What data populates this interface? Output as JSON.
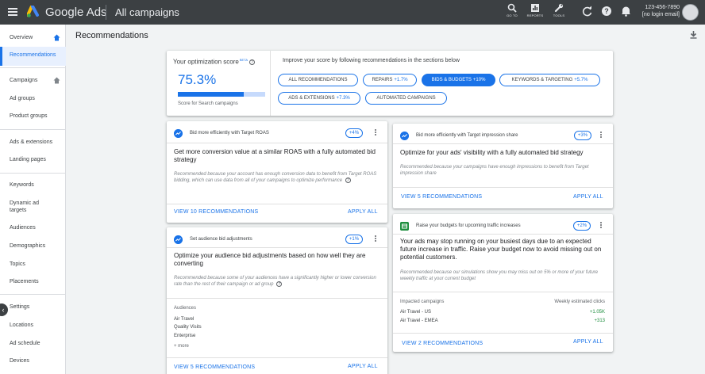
{
  "topbar": {
    "brand": "Google Ads",
    "page_name": "All campaigns",
    "tools": [
      {
        "label": "GO TO",
        "icon": "search-icon"
      },
      {
        "label": "REPORTS",
        "icon": "reports-icon"
      },
      {
        "label": "TOOLS",
        "icon": "wrench-icon"
      }
    ],
    "account_id": "123-456-7890",
    "account_email": "[no login email]"
  },
  "sidebar": {
    "items": [
      {
        "label": "Overview"
      },
      {
        "label": "Recommendations",
        "active": true
      },
      {
        "label": "Campaigns"
      },
      {
        "label": "Ad groups"
      },
      {
        "label": "Product groups"
      },
      {
        "label": "Ads & extensions"
      },
      {
        "label": "Landing pages"
      },
      {
        "label": "Keywords"
      },
      {
        "label": "Dynamic ad targets"
      },
      {
        "label": "Audiences"
      },
      {
        "label": "Demographics"
      },
      {
        "label": "Topics"
      },
      {
        "label": "Placements"
      },
      {
        "label": "Settings"
      },
      {
        "label": "Locations"
      },
      {
        "label": "Ad schedule"
      },
      {
        "label": "Devices"
      }
    ]
  },
  "main": {
    "title": "Recommendations",
    "score": {
      "label": "Your optimization score",
      "beta": "BETA",
      "value": "75.3%",
      "fraction": 0.753,
      "sub": "Score for Search campaigns",
      "improve_text": "Improve your score by following recommendations in the sections below"
    },
    "chips": [
      {
        "label": "ALL RECOMMENDATIONS",
        "delta": ""
      },
      {
        "label": "REPAIRS",
        "delta": "+1.7%"
      },
      {
        "label": "BIDS & BUDGETS",
        "delta": "+10%",
        "active": true
      },
      {
        "label": "KEYWORDS & TARGETING",
        "delta": "+5.7%"
      },
      {
        "label": "ADS & EXTENSIONS",
        "delta": "+7.3%"
      },
      {
        "label": "AUTOMATED CAMPAIGNS",
        "delta": ""
      }
    ],
    "cards": {
      "target_roas": {
        "head": "Bid more efficiently with Target ROAS",
        "uplift": "+4%",
        "title": "Get more conversion value at a similar ROAS with a fully automated bid strategy",
        "reason": "Recommended because your account has enough conversion data to benefit from Target ROAS bidding, which can use data from all of your campaigns to optimize performance",
        "view": "VIEW 10 RECOMMENDATIONS",
        "apply": "APPLY ALL"
      },
      "audience": {
        "head": "Set audience bid adjustments",
        "uplift": "+1%",
        "title": "Optimize your audience bid adjustments based on how well they are converting",
        "reason": "Recommended because some of your audiences have a significantly higher or lower conversion rate than the rest of their campaign or ad group",
        "audiences_label": "Audiences",
        "audiences": [
          "Air Travel",
          "Quality Visits",
          "Enterprise"
        ],
        "more": "+ more",
        "view": "VIEW 5 RECOMMENDATIONS",
        "apply": "APPLY ALL"
      },
      "impression_share": {
        "head": "Bid more efficiently with Target impression share",
        "uplift": "+3%",
        "title": "Optimize for your ads' visibility with a fully automated bid strategy",
        "reason": "Recommended because your campaigns have enough impressions to benefit from Target impression share",
        "view": "VIEW 5 RECOMMENDATIONS",
        "apply": "APPLY ALL"
      },
      "budgets": {
        "head": "Raise your budgets for upcoming traffic increases",
        "uplift": "+2%",
        "title": "Your ads may stop running on your busiest days due to an expected future increase in traffic. Raise your budget now to avoid missing out on potential customers.",
        "reason": "Recommended because our simulations show you may miss out on 5% or more of your future weekly traffic at your current budget",
        "impacted_label": "Impacted campaigns",
        "clicks_label": "Weekly estimated clicks",
        "rows": [
          {
            "name": "Air Travel - US",
            "value": "+1.05K"
          },
          {
            "name": "Air Travel - EMEA",
            "value": "+313"
          }
        ],
        "view": "VIEW 2 RECOMMENDATIONS",
        "apply": "APPLY ALL"
      }
    }
  }
}
